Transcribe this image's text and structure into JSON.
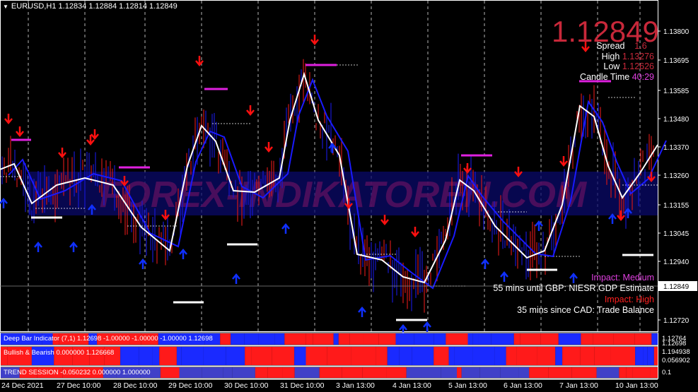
{
  "header": {
    "symbol_line": "EURUSD,H1  1.12834 1.12884 1.12814 1.12849",
    "arrow_icon": "triangle-down-icon"
  },
  "info_panel": {
    "big_price": "1.12849",
    "spread_label": "Spread",
    "spread_value": "1.6",
    "high_label": "High",
    "high_value": "1.13276",
    "low_label": "Low",
    "low_value": "1.12626",
    "candle_label": "Candle Time",
    "candle_value": "40:29",
    "colors": {
      "big_price": "#c8283a",
      "value": "#c8283a",
      "candle_value": "#e040e0"
    }
  },
  "news": {
    "impact1_label": "Impact: Medium",
    "impact1_text": "55 mins until GBP: NIESR GDP Estimate",
    "impact2_label": "Impact: High",
    "impact2_text": "35 mins since CAD: Trade Balance",
    "colors": {
      "medium": "#e040e0",
      "high": "#ff2020"
    }
  },
  "watermark": "FOREX-INDIKATOREN.COM",
  "price_axis": {
    "labels": [
      "1.13800",
      "1.13695",
      "1.13585",
      "1.13480",
      "1.13370",
      "1.13260",
      "1.13155",
      "1.13045",
      "1.12940",
      "1.12720"
    ],
    "current_price": "1.12849"
  },
  "time_axis": {
    "labels": [
      "24 Dec 2021",
      "27 Dec 10:00",
      "28 Dec 10:00",
      "29 Dec 10:00",
      "30 Dec 10:00",
      "31 Dec 10:00",
      "3 Jan 13:00",
      "4 Jan 13:00",
      "5 Jan 13:00",
      "6 Jan 13:00",
      "7 Jan 13:00",
      "10 Jan 13:00"
    ]
  },
  "subwindows": [
    {
      "label": "Deep Bar Indicator (7,1) 1.12698 -1.00000 -1.00000 -1.00000 1.12698",
      "axis_labels": [
        "1.12764",
        "1.12698"
      ]
    },
    {
      "label": "Bullish & Bearish 0.000000 1.126668",
      "axis_labels": [
        "1.194938",
        "0.056902"
      ]
    },
    {
      "label": "TREND SESSION -0.050232 0.000000 1.000000",
      "axis_labels": [
        "0.1"
      ]
    }
  ],
  "colors": {
    "background": "#000000",
    "up_arrow": "#1030ff",
    "down_arrow": "#ff1010",
    "white_line": "#ffffff",
    "blue_line": "#1a1aff",
    "bull_block": "#ff1a1a",
    "bear_block": "#1a2aff",
    "magenta_level": "#e020e0",
    "white_level": "#ffffff",
    "session_blue": "#4040c8"
  }
}
